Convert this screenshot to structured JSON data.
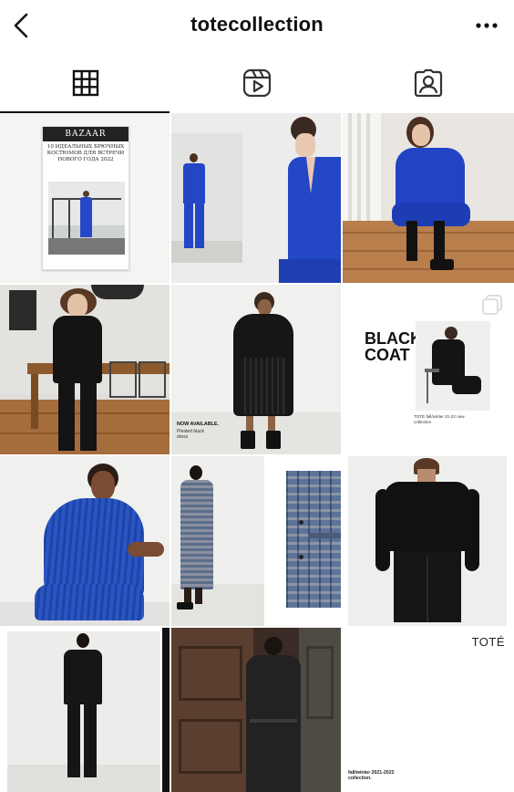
{
  "header": {
    "username": "totecollection",
    "back_icon": "chevron-left-icon",
    "more_icon": "more-horizontal-icon"
  },
  "tabs": [
    {
      "label": "Posts",
      "icon": "grid-icon",
      "active": true
    },
    {
      "label": "Reels",
      "icon": "reels-icon",
      "active": false
    },
    {
      "label": "Tagged",
      "icon": "tagged-user-icon",
      "active": false
    }
  ],
  "posts": {
    "p1": {
      "brand": "BAZAAR",
      "headline": "10 ИДЕАЛЬНЫХ БРЮЧНЫХ КОСТЮМОВ ДЛЯ ВСТРЕЧИ НОВОГО ГОДА 2022"
    },
    "p6": {
      "caption_title": "NOW AVAILABLE.",
      "caption_body": "Pleated black dress"
    },
    "p7": {
      "headline_line1": "BLACK",
      "headline_line2": "COAT",
      "caption": "TOTÉ fall/winter 21-22 new collection",
      "multi_icon": "carousel-icon"
    },
    "p12": {
      "brand": "TOTÉ",
      "caption": "fall/winter 2021-2022 collection."
    }
  },
  "colors": {
    "accent_blue": "#2a48b8",
    "cobalt": "#1f3fb0",
    "black": "#111111"
  }
}
